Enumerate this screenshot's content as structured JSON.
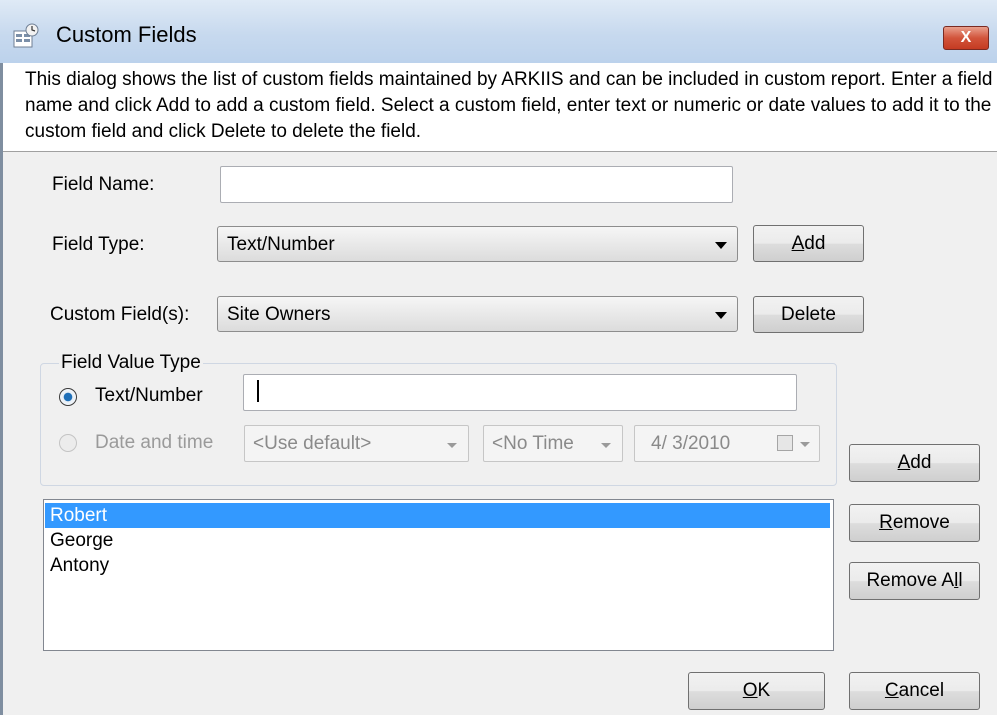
{
  "window": {
    "title": "Custom Fields",
    "close_label": "X"
  },
  "description": "This dialog shows the list of custom fields maintained by ARKIIS and can be included in custom report. Enter a field name and click Add to add a custom field. Select a custom field, enter text or numeric or date values to add it to the custom field and click Delete to delete the field.",
  "form": {
    "field_name_label": "Field Name:",
    "field_name_value": "",
    "field_type_label": "Field Type:",
    "field_type_value": "Text/Number",
    "custom_fields_label": "Custom Field(s):",
    "custom_fields_value": "Site Owners",
    "add_button": {
      "accel": "A",
      "rest": "dd"
    },
    "delete_button": "Delete"
  },
  "field_value_type": {
    "group_label": "Field Value Type",
    "text_number_label": "Text/Number",
    "text_number_value": "",
    "date_time_label": "Date and time",
    "date_format_value": "<Use default>",
    "time_value": "<No Time",
    "date_value": "4/  3/2010"
  },
  "values_list": {
    "items": [
      "Robert",
      "George",
      "Antony"
    ],
    "selected_index": 0
  },
  "buttons": {
    "add": {
      "accel": "A",
      "rest": "dd"
    },
    "remove": {
      "accel": "R",
      "rest": "emove"
    },
    "remove_all": {
      "pre": "Remove A",
      "accel": "l",
      "rest": "l"
    },
    "ok": {
      "accel": "O",
      "rest": "K"
    },
    "cancel": {
      "accel": "C",
      "rest": "ancel"
    }
  },
  "colors": {
    "selection": "#3399ff",
    "dialog_bg": "#f0f0f0",
    "close_red": "#c43b22"
  },
  "icons": {
    "app": "form-icon",
    "close": "close-icon",
    "calendar": "calendar-icon"
  }
}
